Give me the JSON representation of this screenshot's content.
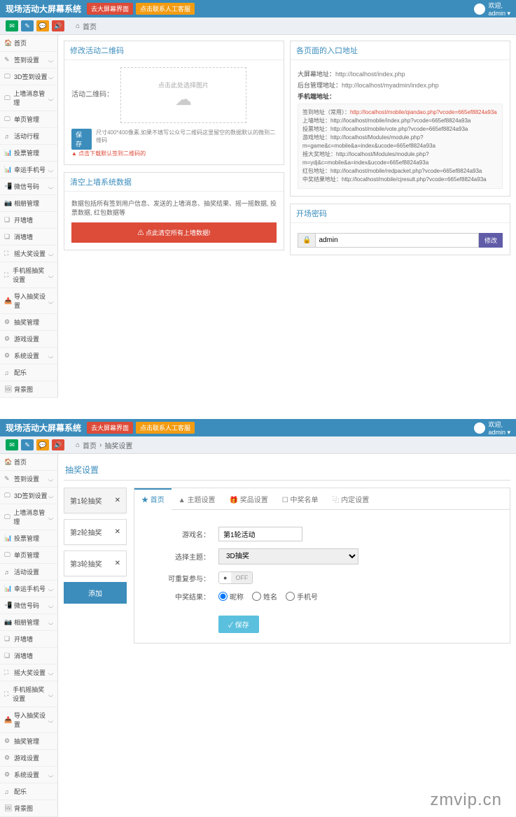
{
  "brand": "现场活动大屏幕系统",
  "top_buttons": {
    "red": "去大屏幕界面",
    "orange": "点击联系人工客服"
  },
  "user": {
    "welcome": "欢迎,",
    "name": "admin"
  },
  "breadcrumb1": {
    "home": "首页"
  },
  "breadcrumb2": {
    "home": "首页",
    "sub": "抽奖设置"
  },
  "sidebar_items": [
    {
      "icon": "🏠",
      "label": "首页",
      "caret": ""
    },
    {
      "icon": "✎",
      "label": "签到设置",
      "caret": "◡"
    },
    {
      "icon": "🖵",
      "label": "3D签到设置",
      "caret": "◡"
    },
    {
      "icon": "🖵",
      "label": "上墙消息管理",
      "caret": "◡"
    },
    {
      "icon": "🖵",
      "label": "单页管理",
      "caret": ""
    },
    {
      "icon": "♬",
      "label": "活动行程",
      "caret": ""
    },
    {
      "icon": "📊",
      "label": "投票管理",
      "caret": ""
    },
    {
      "icon": "📊",
      "label": "幸运手机号",
      "caret": "◡"
    },
    {
      "icon": "📲",
      "label": "微信号码",
      "caret": "◡"
    },
    {
      "icon": "📷",
      "label": "相册管理",
      "caret": ""
    },
    {
      "icon": "❏",
      "label": "开墙墙",
      "caret": ""
    },
    {
      "icon": "❏",
      "label": "消墙墙",
      "caret": ""
    },
    {
      "icon": "⛶",
      "label": "摇大奖设置",
      "caret": "◡"
    },
    {
      "icon": "⛶",
      "label": "手机摇抽奖设置",
      "caret": "◡"
    },
    {
      "icon": "📥",
      "label": "导入抽奖设置",
      "caret": "◡"
    },
    {
      "icon": "⚙",
      "label": "抽奖管理",
      "caret": ""
    },
    {
      "icon": "⚙",
      "label": "游戏设置",
      "caret": ""
    },
    {
      "icon": "⚙",
      "label": "系统设置",
      "caret": "◡"
    },
    {
      "icon": "♫",
      "label": "配乐",
      "caret": ""
    },
    {
      "icon": "🖼",
      "label": "背景图",
      "caret": ""
    }
  ],
  "sidebar_items2": [
    {
      "icon": "🏠",
      "label": "首页",
      "caret": ""
    },
    {
      "icon": "✎",
      "label": "签到设置",
      "caret": "◡"
    },
    {
      "icon": "🖵",
      "label": "3D签到设置",
      "caret": "◡"
    },
    {
      "icon": "🖵",
      "label": "上墙消息管理",
      "caret": "◡"
    },
    {
      "icon": "📊",
      "label": "投票管理",
      "caret": ""
    },
    {
      "icon": "🖵",
      "label": "单页管理",
      "caret": ""
    },
    {
      "icon": "♬",
      "label": "活动设置",
      "caret": ""
    },
    {
      "icon": "📊",
      "label": "幸运手机号",
      "caret": "◡"
    },
    {
      "icon": "📲",
      "label": "微信号码",
      "caret": "◡"
    },
    {
      "icon": "📷",
      "label": "相册管理",
      "caret": "◡"
    },
    {
      "icon": "❏",
      "label": "开墙墙",
      "caret": ""
    },
    {
      "icon": "❏",
      "label": "消墙墙",
      "caret": ""
    },
    {
      "icon": "⛶",
      "label": "摇大奖设置",
      "caret": "◡"
    },
    {
      "icon": "⛶",
      "label": "手机摇抽奖设置",
      "caret": "◡"
    },
    {
      "icon": "📥",
      "label": "导入抽奖设置",
      "caret": "◡"
    },
    {
      "icon": "⚙",
      "label": "抽奖管理",
      "caret": ""
    },
    {
      "icon": "⚙",
      "label": "游戏设置",
      "caret": ""
    },
    {
      "icon": "⚙",
      "label": "系统设置",
      "caret": "◡"
    },
    {
      "icon": "♫",
      "label": "配乐",
      "caret": ""
    },
    {
      "icon": "🖼",
      "label": "背景图",
      "caret": ""
    }
  ],
  "qr_panel": {
    "title": "修改活动二维码",
    "label": "活动二维码：",
    "upload_hint": "点击此处选择图片",
    "save": "保存",
    "save_hint": "尺寸400*400像素,如果不填写公众号二维码这里留空的数据默认的微到二维码",
    "warn": "▲ 点击下载默认签到二维码的"
  },
  "clear_panel": {
    "title": "清空上墙系统数据",
    "desc": "数据包括所有签到用户信息、发送的上墙消息、抽奖结果、摇一摇数据, 投票数据, 红包数据等",
    "banner": "⚠ 点此清空所有上墙数据!"
  },
  "url_panel": {
    "title": "各页面的入口地址",
    "big_label": "大屏幕地址：",
    "big_url": "http://localhost/index.php",
    "admin_label": "后台管理地址：",
    "admin_url": "http://localhost/myadmin/index.php",
    "mobile_label": "手机端地址：",
    "m1_label": "签到地址（常用）：",
    "m1_url": "http://localhost/mobile/qiandao.php?vcode=665ef8824a93a",
    "m2_label": "上墙地址：",
    "m2_url": "http://localhost/mobile/index.php?vcode=665ef8824a93a",
    "m3_label": "投票地址：",
    "m3_url": "http://localhost/mobile/vote.php?vcode=665ef8824a93a",
    "m4_label": "游戏地址：",
    "m4_url": "http://localhost/Modules/module.php?m=game&c=mobile&a=index&ucode=665ef8824a93a",
    "m5_label": "摇大奖地址：",
    "m5_url": "http://localhost/Modules/module.php?m=ydj&c=mobile&a=index&ucode=665ef8824a93a",
    "m6_label": "红包地址：",
    "m6_url": "http://localhost/mobile/redpacket.php?vcode=665ef8824a93a",
    "m7_label": "中奖结果地址：",
    "m7_url": "http://localhost/mobile/cjresult.php?vcode=665ef8824a93a"
  },
  "pwd_panel": {
    "title": "开场密码",
    "value": "admin",
    "btn": "修改"
  },
  "lottery": {
    "title": "抽奖设置",
    "rounds": [
      "第1轮抽奖",
      "第2轮抽奖",
      "第3轮抽奖"
    ],
    "add": "添加",
    "tabs": [
      "★ 首页",
      "▲ 主题设置",
      "🎁 奖品设置",
      "☐ 中奖名单",
      "⿻ 内定设置"
    ],
    "form": {
      "name_label": "游戏名：",
      "name_value": "第1轮活动",
      "theme_label": "选择主题：",
      "theme_value": "3D抽奖",
      "repeat_label": "可重复参与：",
      "repeat_off": "OFF",
      "result_label": "中奖结果：",
      "result_options": [
        "昵称",
        "姓名",
        "手机号"
      ],
      "submit": "✓ 保存"
    }
  },
  "watermark": "zmvip.cn"
}
